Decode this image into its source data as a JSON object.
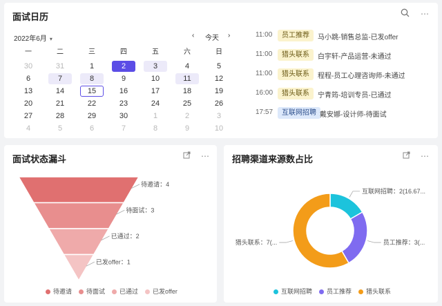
{
  "calendar_card": {
    "title": "面试日历",
    "month": "2022年6月",
    "today_label": "今天",
    "weekdays": [
      "一",
      "二",
      "三",
      "四",
      "五",
      "六",
      "日"
    ],
    "weeks": [
      [
        {
          "d": "30",
          "m": true
        },
        {
          "d": "31",
          "m": true
        },
        {
          "d": "1"
        },
        {
          "d": "2",
          "s": "sel"
        },
        {
          "d": "3",
          "s": "hl"
        },
        {
          "d": "4"
        },
        {
          "d": "5"
        }
      ],
      [
        {
          "d": "6"
        },
        {
          "d": "7",
          "s": "hl"
        },
        {
          "d": "8",
          "s": "hl"
        },
        {
          "d": "9"
        },
        {
          "d": "10"
        },
        {
          "d": "11",
          "s": "hl"
        },
        {
          "d": "12"
        }
      ],
      [
        {
          "d": "13"
        },
        {
          "d": "14"
        },
        {
          "d": "15",
          "s": "today"
        },
        {
          "d": "16"
        },
        {
          "d": "17"
        },
        {
          "d": "18"
        },
        {
          "d": "19"
        }
      ],
      [
        {
          "d": "20"
        },
        {
          "d": "21"
        },
        {
          "d": "22"
        },
        {
          "d": "23"
        },
        {
          "d": "24"
        },
        {
          "d": "25"
        },
        {
          "d": "26"
        }
      ],
      [
        {
          "d": "27"
        },
        {
          "d": "28"
        },
        {
          "d": "29"
        },
        {
          "d": "30"
        },
        {
          "d": "1",
          "m": true
        },
        {
          "d": "2",
          "m": true
        },
        {
          "d": "3",
          "m": true
        }
      ],
      [
        {
          "d": "4",
          "m": true
        },
        {
          "d": "5",
          "m": true
        },
        {
          "d": "6",
          "m": true
        },
        {
          "d": "7",
          "m": true
        },
        {
          "d": "8",
          "m": true
        },
        {
          "d": "9",
          "m": true
        },
        {
          "d": "10",
          "m": true
        }
      ]
    ],
    "schedule": [
      {
        "time": "11:00",
        "tag": "员工推荐",
        "tag_color": "yellow",
        "text": "马小跳-销售总监-已发offer"
      },
      {
        "time": "11:00",
        "tag": "猎头联系",
        "tag_color": "yellow",
        "text": "白宇轩-产品运营-未通过"
      },
      {
        "time": "11:00",
        "tag": "猎头联系",
        "tag_color": "yellow",
        "text": "程程-员工心理咨询师-未通过"
      },
      {
        "time": "16:00",
        "tag": "猎头联系",
        "tag_color": "yellow",
        "text": "宁青筠-培训专员-已通过"
      },
      {
        "time": "17:57",
        "tag": "互联网招聘",
        "tag_color": "blue",
        "text": "戴安娜-设计师-待面试"
      }
    ]
  },
  "funnel_card": {
    "title": "面试状态漏斗",
    "chart_data": {
      "type": "funnel",
      "categories": [
        "待邀请",
        "待面试",
        "已通过",
        "已发offer"
      ],
      "values": [
        4,
        3,
        2,
        1
      ],
      "labels": [
        "待邀请：4",
        "待面试：3",
        "已通过：2",
        "已发offer：1"
      ],
      "colors": [
        "#e07070",
        "#e88e8e",
        "#efaaaa",
        "#f4c4c4"
      ],
      "legend": "bottom"
    }
  },
  "pie_card": {
    "title": "招聘渠道来源数占比",
    "chart_data": {
      "type": "pie",
      "categories": [
        "互联网招聘",
        "员工推荐",
        "猎头联系"
      ],
      "values": [
        2,
        3,
        7
      ],
      "labels": [
        "互联网招聘：2(16.67...",
        "员工推荐：3(...",
        "猎头联系：7(..."
      ],
      "colors": [
        "#1cc3dc",
        "#7f6bf0",
        "#f39c19"
      ],
      "legend": "bottom"
    }
  },
  "icons": {
    "search": "search-icon",
    "more": "more-icon",
    "expand": "expand-icon"
  }
}
